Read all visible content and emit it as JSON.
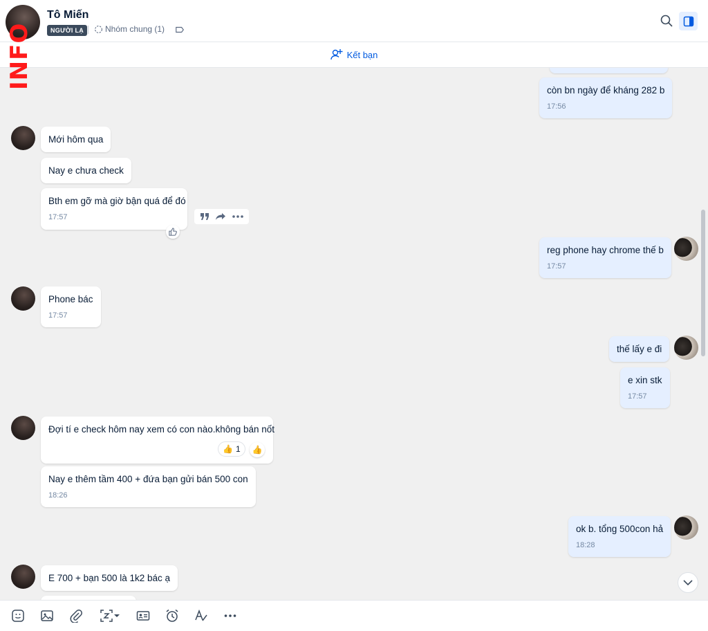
{
  "header": {
    "contact_name": "Tô Miến",
    "stranger_tag": "NGƯỜI LẠ",
    "common_groups": "Nhóm chung (1)",
    "watermark": "INFO"
  },
  "friend_bar": {
    "label": "Kết bạn"
  },
  "messages": [
    {
      "text": "còn bn ngày để kháng 282 b",
      "time": "17:56"
    },
    {
      "text": "Mới hôm qua"
    },
    {
      "text": "Nay e chưa check"
    },
    {
      "text": "Bth em gỡ mà giờ bận quá để đó",
      "time": "17:57"
    },
    {
      "text": "reg phone hay chrome thế b",
      "time": "17:57"
    },
    {
      "text": "Phone bác",
      "time": "17:57"
    },
    {
      "text": "thế lấy e đi"
    },
    {
      "text": "e xin stk",
      "time": "17:57"
    },
    {
      "text": "Đợi tí e check hôm nay xem có con nào.không bán nốt",
      "reaction_count": "1"
    },
    {
      "text": "Nay e thêm tầm 400 + đứa bạn gửi bán 500 con",
      "time": "18:26"
    },
    {
      "text": "ok b. tổng 500con hả",
      "time": "18:28"
    },
    {
      "text": "E 700 + bạn 500 là 1k2 bác ạ"
    }
  ],
  "colors": {
    "accent": "#005ae0",
    "my_bubble": "#e5efff",
    "chat_bg": "#f0f0f0",
    "watermark": "#ff1a1a"
  }
}
